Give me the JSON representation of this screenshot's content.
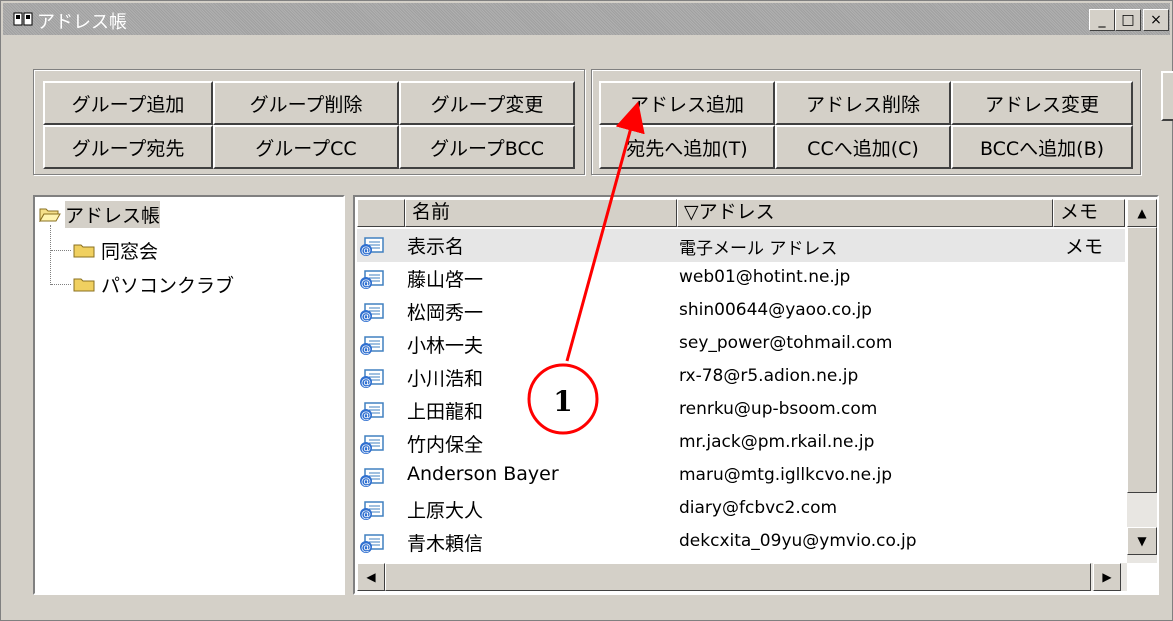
{
  "window": {
    "title": "アドレス帳",
    "title_icon": "address-book-icon",
    "minimize_label": "_",
    "maximize_label": "□",
    "close_label": "×"
  },
  "group_buttons": {
    "add": "グループ追加",
    "delete": "グループ削除",
    "change": "グループ変更",
    "to": "グループ宛先",
    "cc": "グループCC",
    "bcc": "グループBCC"
  },
  "address_buttons": {
    "add": "アドレス追加",
    "delete": "アドレス削除",
    "change": "アドレス変更",
    "add_to": "宛先へ追加(T)",
    "add_cc": "CCへ追加(C)",
    "add_bcc": "BCCへ追加(B)"
  },
  "tree": {
    "root": "アドレス帳",
    "children": [
      "同窓会",
      "パソコンクラブ"
    ]
  },
  "list": {
    "columns": {
      "name": "名前",
      "address": "▽アドレス",
      "memo": "メモ"
    },
    "rows": [
      {
        "name": "表示名",
        "address": "電子メール アドレス",
        "memo": "メモ"
      },
      {
        "name": "藤山啓一",
        "address": "web01@hotint.ne.jp",
        "memo": ""
      },
      {
        "name": "松岡秀一",
        "address": "shin00644@yaoo.co.jp",
        "memo": ""
      },
      {
        "name": "小林一夫",
        "address": "sey_power@tohmail.com",
        "memo": ""
      },
      {
        "name": "小川浩和",
        "address": "rx-78@r5.adion.ne.jp",
        "memo": ""
      },
      {
        "name": "上田龍和",
        "address": "renrku@up-bsoom.com",
        "memo": ""
      },
      {
        "name": "竹内保全",
        "address": "mr.jack@pm.rkail.ne.jp",
        "memo": ""
      },
      {
        "name": "Anderson Bayer",
        "address": "maru@mtg.igllkcvo.ne.jp",
        "memo": ""
      },
      {
        "name": "上原大人",
        "address": "diary@fcbvc2.com",
        "memo": ""
      },
      {
        "name": "青木頼信",
        "address": "dekcxita_09yu@ymvio.co.jp",
        "memo": ""
      }
    ]
  },
  "annotation": {
    "label": "1",
    "color": "#ff0000"
  }
}
